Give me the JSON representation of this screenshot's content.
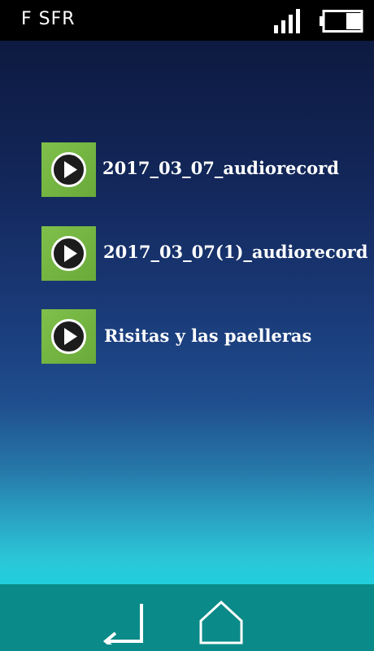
{
  "status_bar": {
    "carrier": "F SFR",
    "icons": [
      "signal-icon",
      "battery-icon"
    ],
    "battery_level": 0.4
  },
  "recordings": [
    {
      "title": "2017_03_07_audiorecord",
      "icon": "play-icon"
    },
    {
      "title": "2017_03_07(1)_audiorecord",
      "icon": "play-icon"
    },
    {
      "title": "Risitas y las paelleras",
      "icon": "play-icon"
    }
  ],
  "nav_bar": {
    "icons": [
      "back-icon",
      "home-icon"
    ]
  },
  "colors": {
    "thumb_green": "#7fbf4a",
    "nav_teal": "#0a8a88",
    "top_dark": "#0b1638",
    "bottom_cyan": "#20d0dd"
  }
}
